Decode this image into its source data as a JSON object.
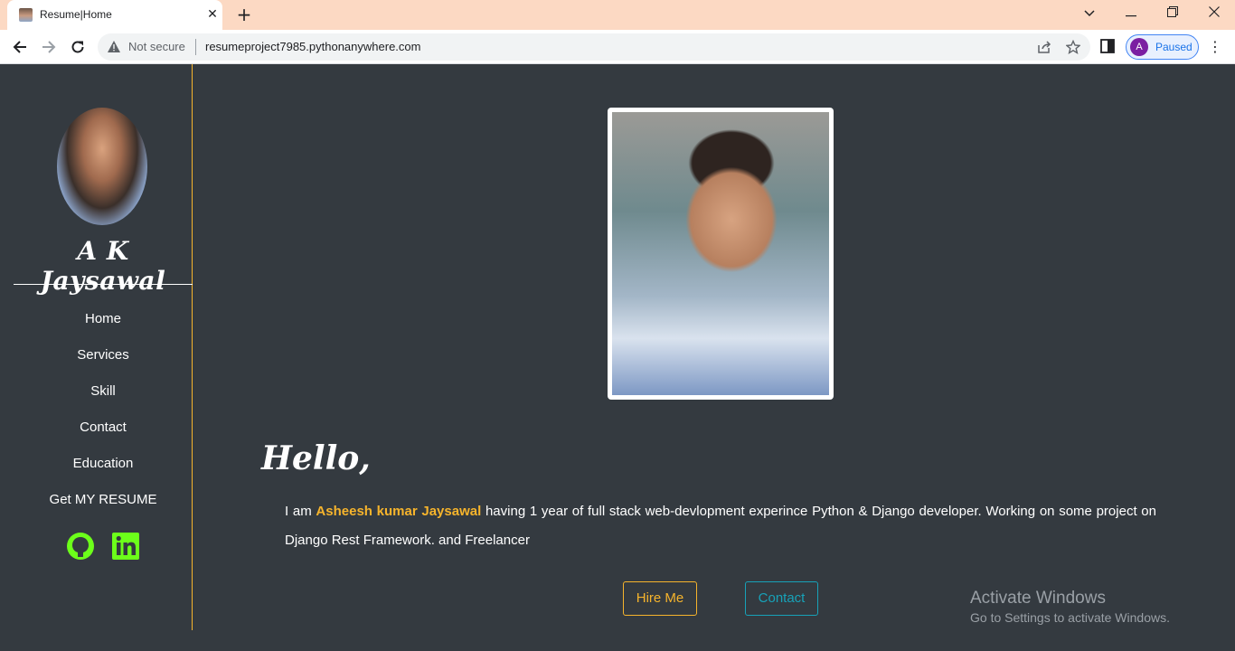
{
  "browser": {
    "tab_title": "Resume|Home",
    "security_label": "Not secure",
    "url": "resumeproject7985.pythonanywhere.com",
    "profile_initial": "A",
    "profile_status": "Paused"
  },
  "sidebar": {
    "name": "A K Jaysawal",
    "nav": [
      "Home",
      "Services",
      "Skill",
      "Contact",
      "Education",
      "Get MY RESUME"
    ],
    "social_icons": [
      "github-icon",
      "linkedin-icon"
    ],
    "social_color": "#6cff1a"
  },
  "main": {
    "greeting": "Hello,",
    "intro_prefix": "I am ",
    "intro_name": "Asheesh kumar Jaysawal",
    "intro_suffix": " having 1 year of full stack web-devlopment experince Python & Django developer. Working on some project on Django Rest Framework. and Freelancer",
    "hire_button": "Hire Me",
    "contact_button": "Contact"
  },
  "watermark": {
    "title": "Activate Windows",
    "subtitle": "Go to Settings to activate Windows."
  },
  "colors": {
    "accent": "#f6b42c",
    "contact": "#17a2b8",
    "background": "#343a40"
  }
}
